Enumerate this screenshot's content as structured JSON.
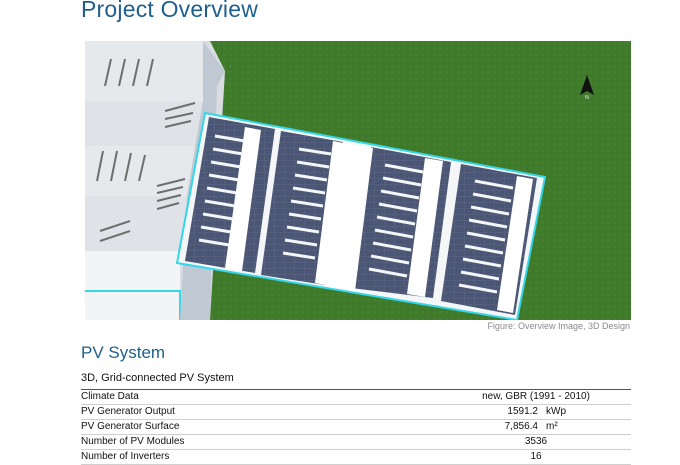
{
  "page": {
    "title": "Project Overview",
    "figure_caption": "Figure: Overview Image, 3D Design",
    "compass_label": "N"
  },
  "pv_system": {
    "heading": "PV System",
    "subheading": "3D, Grid-connected PV System",
    "rows": [
      {
        "label": "Climate Data",
        "value": "new, GBR (1991 - 2010)",
        "unit": ""
      },
      {
        "label": "PV Generator Output",
        "value": "1591.2",
        "unit": "kWp"
      },
      {
        "label": "PV Generator Surface",
        "value": "7,856.4",
        "unit": "m²"
      },
      {
        "label": "Number of PV Modules",
        "value": "3536",
        "unit": ""
      },
      {
        "label": "Number of Inverters",
        "value": "16",
        "unit": ""
      }
    ]
  },
  "colors": {
    "heading": "#1f5f8b",
    "grass": "#3f7a2a",
    "roof": "#e9ecef",
    "panel": "#4d5a7a",
    "outline": "#35d6e8"
  }
}
